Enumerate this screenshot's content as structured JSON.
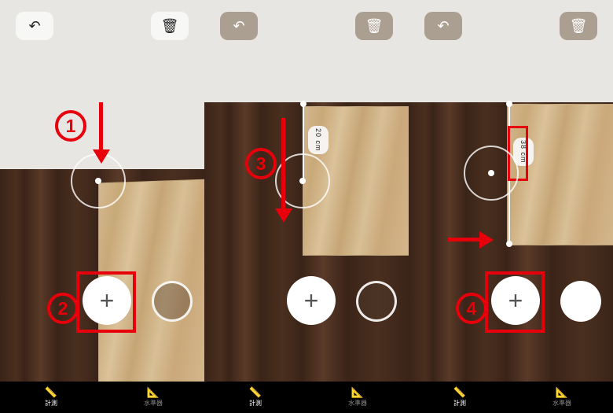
{
  "annotation_color": "#e7000b",
  "screens": [
    {
      "toolbar": {
        "undo_icon": "↶",
        "delete_icon": "🗑"
      },
      "add_label": "+",
      "nav": {
        "measure": "計測",
        "level": "水準器"
      },
      "annotations": {
        "step1": "1",
        "step2": "2"
      }
    },
    {
      "toolbar": {
        "undo_icon": "↶",
        "delete_icon": "🗑"
      },
      "add_label": "+",
      "nav": {
        "measure": "計測",
        "level": "水準器"
      },
      "measurement": "20 cm",
      "annotations": {
        "step3": "3"
      }
    },
    {
      "toolbar": {
        "undo_icon": "↶",
        "delete_icon": "🗑"
      },
      "add_label": "+",
      "nav": {
        "measure": "計測",
        "level": "水準器"
      },
      "measurement": "38 cm",
      "annotations": {
        "step4": "4"
      }
    }
  ]
}
